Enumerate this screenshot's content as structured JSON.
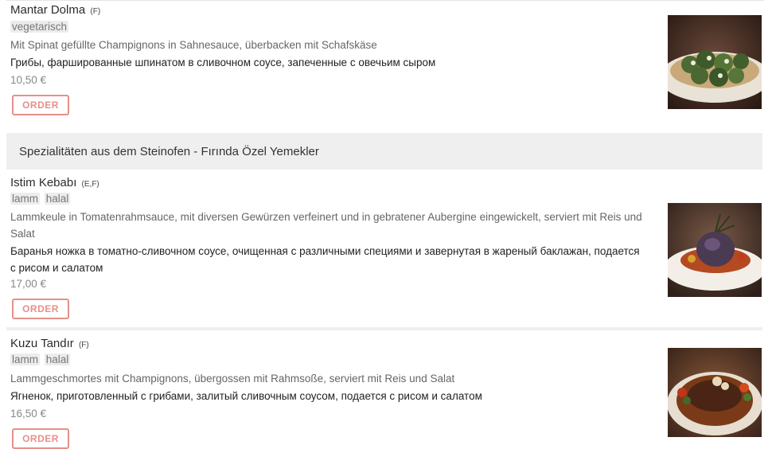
{
  "items": [
    {
      "title": "Mantar Dolma",
      "allergens": "(F)",
      "tags": [
        "vegetarisch"
      ],
      "desc_de": "Mit Spinat gefüllte Champignons in Sahnesauce, überbacken mit Schafskäse",
      "desc_ru": "Грибы, фаршированные шпинатом в сливочном соусе, запеченные с овечьим сыром",
      "price": "10,50 €",
      "order_label": "ORDER"
    },
    {
      "title": "Istim Kebabı",
      "allergens": "(E,F)",
      "tags": [
        "lamm",
        "halal"
      ],
      "desc_de": "Lammkeule in Tomatenrahmsauce, mit diversen Gewürzen verfeinert und in gebratener Aubergine eingewickelt, serviert mit Reis und Salat",
      "desc_ru": "Баранья ножка в томатно-сливочном соусе, очищенная с различными специями и завернутая в жареный баклажан, подается с рисом и салатом",
      "price": "17,00 €",
      "order_label": "ORDER"
    },
    {
      "title": "Kuzu Tandır",
      "allergens": "(F)",
      "tags": [
        "lamm",
        "halal"
      ],
      "desc_de": "Lammgeschmortes mit Champignons, übergossen mit Rahmsoße, serviert mit Reis und Salat",
      "desc_ru": "Ягненок, приготовленный с грибами, залитый сливочным соусом, подается с рисом и салатом",
      "price": "16,50 €",
      "order_label": "ORDER"
    }
  ],
  "section": {
    "title": "Spezialitäten aus dem Steinofen - Fırında Özel Yemekler"
  },
  "colors": {
    "accent": "#e5908a",
    "section_bg": "#efefef",
    "tag_bg": "#ececec"
  },
  "icons": [
    "mantar-dolma-photo",
    "istim-kebabi-photo",
    "kuzu-tandir-photo"
  ]
}
